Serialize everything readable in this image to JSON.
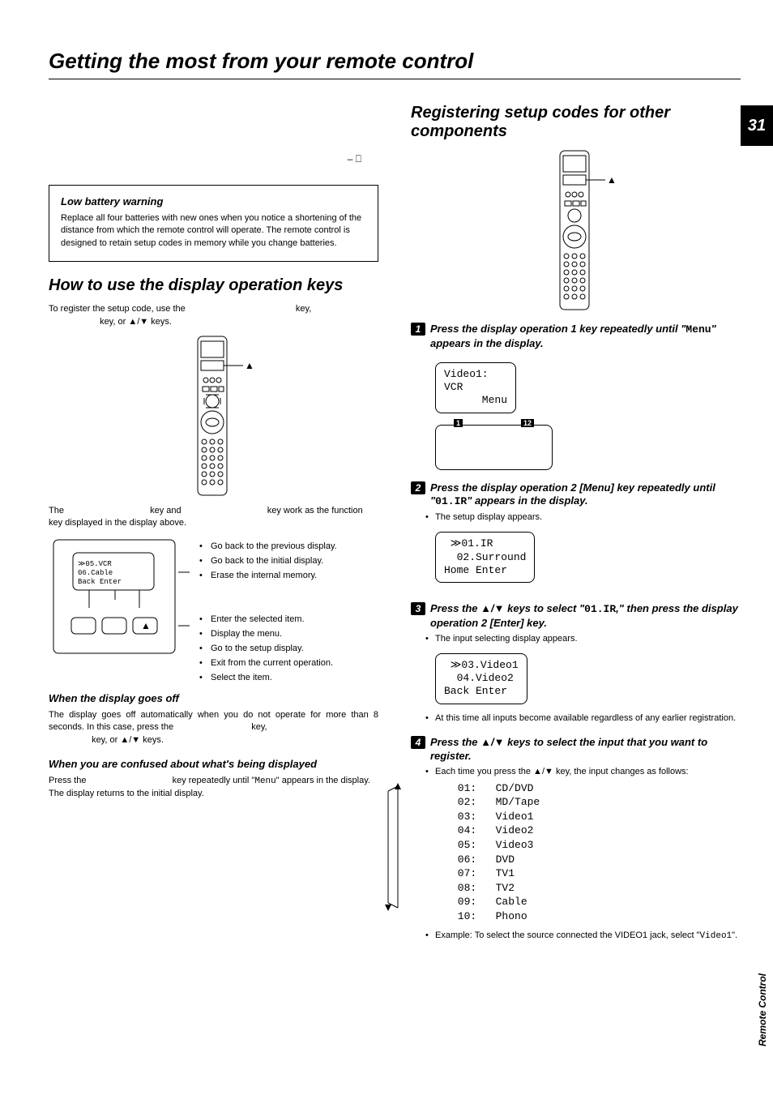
{
  "page": {
    "title": "Getting the most from your remote control",
    "number": "31",
    "side_label": "Remote Control"
  },
  "lowbatt": {
    "heading": "Low battery warning",
    "body": "Replace all four batteries with new ones when you notice a shortening of the distance from which the remote control will operate. The remote control is designed to retain setup codes in memory while you change batteries."
  },
  "howto": {
    "heading": "How to use the display operation keys",
    "intro_a": "To register the setup code, use the ",
    "intro_b": " key, ",
    "intro_c": " key, or ▲/▼ keys.",
    "funcline_a": "The ",
    "funcline_b": " key and ",
    "funcline_c": " key work as the function key displayed in the display above.",
    "display_lines": "  ≫05.VCR\n  06.Cable\n Back Enter",
    "bullets_left": [
      "Go back to the previous display.",
      "Go back to the initial display.",
      "Erase the internal memory."
    ],
    "bullets_right": [
      "Enter the selected item.",
      "Display the menu.",
      "Go to the setup display.",
      "Exit from the current operation.",
      "Select the item."
    ],
    "goes_off_heading": "When the display goes off",
    "goes_off_body_a": "The display goes off automatically when you do not operate for more than 8 seconds. In this case, press the ",
    "goes_off_body_b": " key, ",
    "goes_off_body_c": " key, or ▲/▼ keys.",
    "confused_heading": "When you are confused about what's being displayed",
    "confused_a": "Press the ",
    "confused_b": " key repeatedly until \"",
    "confused_c": "\" appears in the display.",
    "confused_d": "The display returns to the initial display.",
    "menu_mono": "Menu"
  },
  "register": {
    "heading": "Registering setup codes for other components",
    "step1_a": "Press the display operation 1 key repeatedly until \"",
    "step1_menu": "Menu",
    "step1_b": "\" appears in the display.",
    "disp1": "Video1:\nVCR\n      Menu",
    "op_label_1": "1",
    "op_label_2": "12",
    "step2_a": "Press the display operation 2 [Menu] key repeatedly until \"",
    "step2_code": "01.IR",
    "step2_b": "\" appears in the display.",
    "step2_bullet": "The setup display appears.",
    "disp2": " ≫01.IR\n  02.Surround\nHome Enter",
    "step3_a": "Press the ▲/▼ keys to select \"",
    "step3_code": "01.IR",
    "step3_b": ",\" then press the display operation 2 [Enter] key.",
    "step3_bullet": "The input selecting display appears.",
    "disp3": " ≫03.Video1\n  04.Video2\nBack Enter",
    "step3_note": "At this time all inputs become available regardless of any earlier registration.",
    "step4": "Press the ▲/▼ keys to select the input that you want to register.",
    "step4_bullet": "Each time you press the ▲/▼ key, the input changes as follows:",
    "inputs": " 01:   CD/DVD\n 02:   MD/Tape\n 03:   Video1\n 04:   Video2\n 05:   Video3\n 06:   DVD\n 07:   TV1\n 08:   TV2\n 09:   Cable\n 10:   Phono",
    "example_a": "Example: To select the source connected the VIDEO1 jack, select \"",
    "example_code": "Video1",
    "example_b": "\"."
  }
}
